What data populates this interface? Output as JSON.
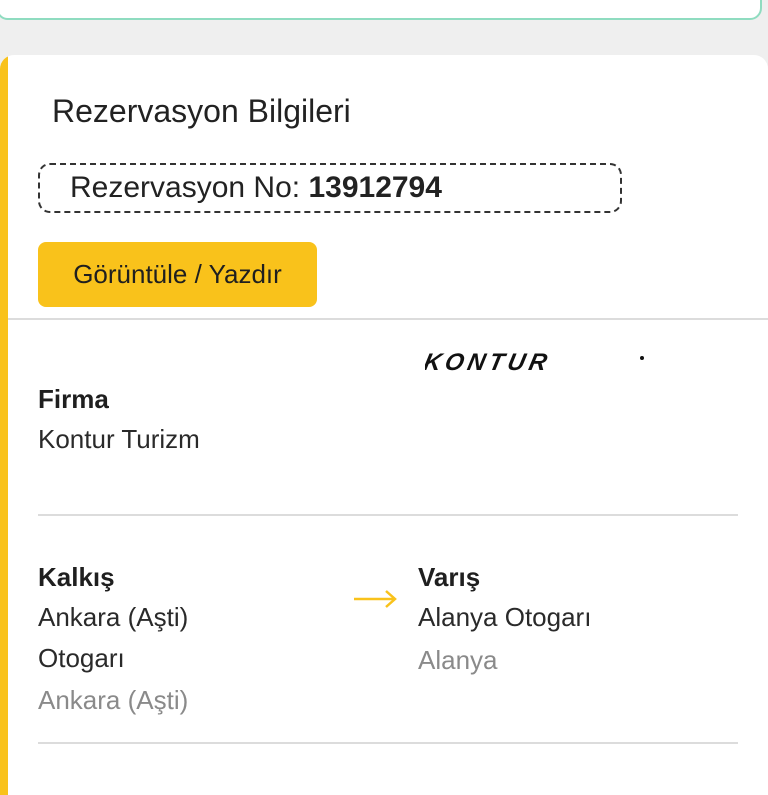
{
  "reservation": {
    "title": "Rezervasyon Bilgileri",
    "number_label": "Rezervasyon No:",
    "number": "13912794",
    "view_print_label": "Görüntüle / Yazdır"
  },
  "company": {
    "label": "Firma",
    "name": "Kontur Turizm",
    "logo_text": "KONTUR"
  },
  "route": {
    "departure": {
      "label": "Kalkış",
      "station_line1": "Ankara (Aşti)",
      "station_line2": "Otogarı",
      "city": "Ankara (Aşti)"
    },
    "arrival": {
      "label": "Varış",
      "station": "Alanya Otogarı",
      "city": "Alanya"
    },
    "arrow_icon": "arrow-right-icon"
  },
  "colors": {
    "accent": "#f9c21b",
    "top_border": "#8fdcc0",
    "muted_text": "#8a8a8a"
  }
}
